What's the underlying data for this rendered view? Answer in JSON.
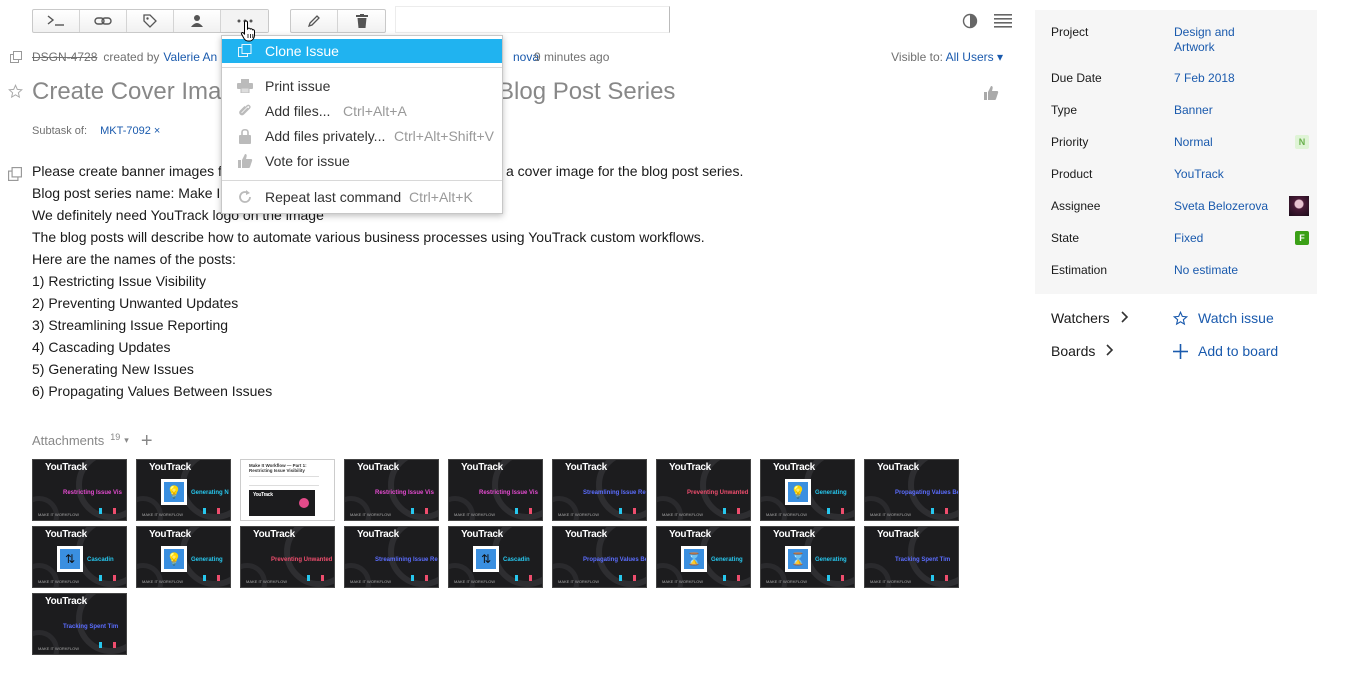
{
  "toolbar": {
    "buttons": [
      "command-dialog",
      "link",
      "tag",
      "assign",
      "more",
      "edit",
      "delete"
    ]
  },
  "issue": {
    "id": "DSGN-4728",
    "created_by_prefix": "created by",
    "creator": "Valerie An",
    "updater_fragment": "nova",
    "updated_time": "9 minutes ago",
    "visible_to_label": "Visible to:",
    "visible_to_value": "All Users ▾",
    "title_part1": "Create Cover Ima",
    "title_part2": "Blog Post Series",
    "subtask_label": "Subtask of:",
    "subtask_link": "MKT-7092 ×"
  },
  "description": {
    "line1_a": "Please create banner images f",
    "line1_b": "a cover image for the blog post series.",
    "line2": "Blog post series name: Make I",
    "line3": "We definitely need YouTrack logo on the image",
    "line4": "The blog posts will describe how to automate various business processes using YouTrack custom workflows.",
    "line5": "Here are the names of the posts:",
    "posts": [
      "1) Restricting Issue Visibility",
      "2) Preventing Unwanted Updates",
      "3) Streamlining Issue Reporting",
      "4) Cascading Updates",
      "5) Generating New Issues",
      "6) Propagating Values Between Issues"
    ]
  },
  "attachments": {
    "label": "Attachments",
    "count": "19",
    "caret": "▾",
    "add": "+",
    "thumb_logo": "YouTrack",
    "thumb_footer": "MAKE IT WORKFLOW",
    "items": [
      {
        "kind": "text",
        "text": "Restricting Issue Vis",
        "color": "pink"
      },
      {
        "kind": "icon",
        "icon": "💡",
        "text": "Generating N",
        "color": "cyan"
      },
      {
        "kind": "doc",
        "text": "Make It Workflow — Part 1: Restricting Issue Visibility"
      },
      {
        "kind": "text",
        "text": "Restricting Issue Vis",
        "color": "pink"
      },
      {
        "kind": "text",
        "text": "Restricting Issue Vis",
        "color": "pink"
      },
      {
        "kind": "text",
        "text": "Streamlining Issue Report",
        "color": "blue"
      },
      {
        "kind": "text",
        "text": "Preventing Unwanted Up",
        "color": "red"
      },
      {
        "kind": "icon",
        "icon": "💡",
        "text": "Generating",
        "color": "cyan"
      },
      {
        "kind": "text",
        "text": "Propagating Values Between Issue",
        "color": "blue"
      },
      {
        "kind": "icon",
        "icon": "⇅",
        "text": "Cascadin",
        "color": "cyan"
      },
      {
        "kind": "icon",
        "icon": "💡",
        "text": "Generating",
        "color": "cyan"
      },
      {
        "kind": "text",
        "text": "Preventing Unwanted U",
        "color": "red"
      },
      {
        "kind": "text",
        "text": "Streamlining Issue Report",
        "color": "blue"
      },
      {
        "kind": "icon",
        "icon": "⇅",
        "text": "Cascadin",
        "color": "cyan"
      },
      {
        "kind": "text",
        "text": "Propagating Values Between Issue",
        "color": "blue"
      },
      {
        "kind": "icon",
        "icon": "⌛",
        "text": "Generating",
        "color": "cyan"
      },
      {
        "kind": "icon",
        "icon": "⌛",
        "text": "Generating",
        "color": "cyan"
      },
      {
        "kind": "text",
        "text": "Tracking Spent Tim",
        "color": "blue"
      },
      {
        "kind": "text",
        "text": "Tracking Spent Tim",
        "color": "blue"
      }
    ]
  },
  "menu": {
    "clone": "Clone Issue",
    "print": "Print issue",
    "add_files": "Add files...",
    "add_files_key": "Ctrl+Alt+A",
    "add_files_private": "Add files privately...",
    "add_files_private_key": "Ctrl+Alt+Shift+V",
    "vote": "Vote for issue",
    "repeat": "Repeat last command",
    "repeat_key": "Ctrl+Alt+K"
  },
  "sidebar": {
    "fields": {
      "project": {
        "name": "Project",
        "value": "Design and Artwork"
      },
      "due_date": {
        "name": "Due Date",
        "value": "7 Feb 2018"
      },
      "type": {
        "name": "Type",
        "value": "Banner"
      },
      "priority": {
        "name": "Priority",
        "value": "Normal",
        "badge": "N"
      },
      "product": {
        "name": "Product",
        "value": "YouTrack"
      },
      "assignee": {
        "name": "Assignee",
        "value": "Sveta Belozerova"
      },
      "state": {
        "name": "State",
        "value": "Fixed",
        "badge": "F"
      },
      "estimation": {
        "name": "Estimation",
        "value": "No estimate"
      }
    },
    "watchers_label": "Watchers",
    "watch_action": "Watch issue",
    "boards_label": "Boards",
    "board_action": "Add to board"
  },
  "colors": {
    "link": "#1a5aad",
    "menu_highlight": "#20b3f0",
    "priority_badge": "#dff4d6",
    "state_badge": "#3ba017",
    "sidebar_bg": "#f6f6f6"
  }
}
